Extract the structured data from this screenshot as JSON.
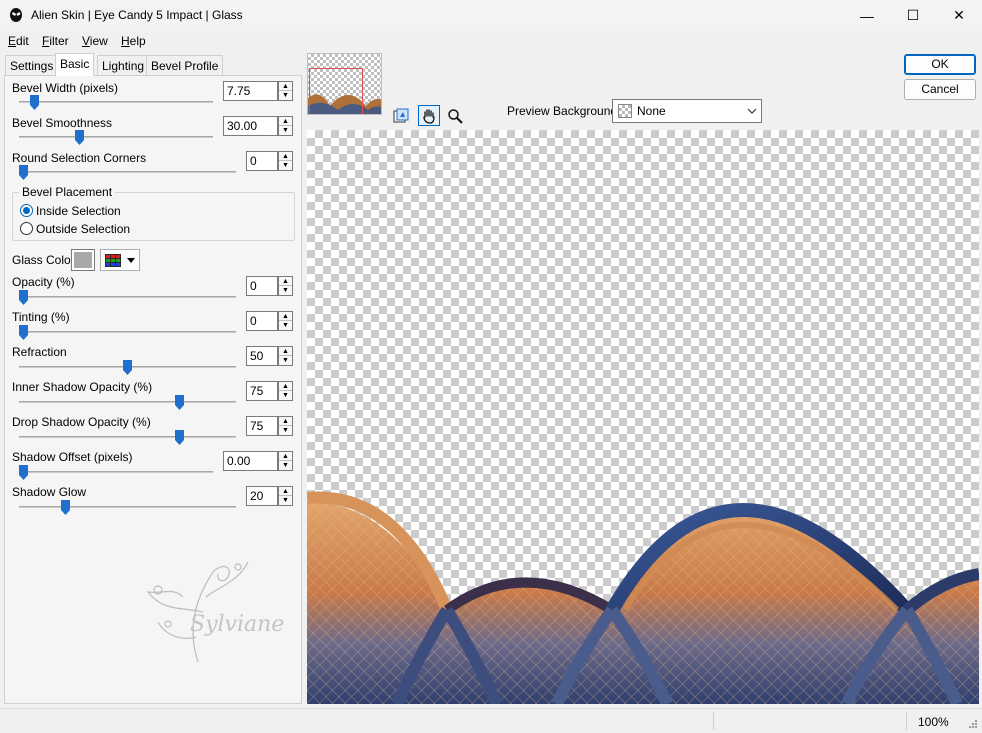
{
  "window": {
    "title": "Alien Skin | Eye Candy 5 Impact | Glass",
    "minimize": "—",
    "maximize": "☐",
    "close": "✕"
  },
  "menu": [
    {
      "label": "Edit",
      "mnemonic": "E",
      "rest": "dit"
    },
    {
      "label": "Filter",
      "mnemonic": "F",
      "rest": "ilter"
    },
    {
      "label": "View",
      "mnemonic": "V",
      "rest": "iew"
    },
    {
      "label": "Help",
      "mnemonic": "H",
      "rest": "elp"
    }
  ],
  "tabs": [
    "Settings",
    "Basic",
    "Lighting",
    "Bevel Profile"
  ],
  "active_tab": "Basic",
  "controls": {
    "bevel_width": {
      "label": "Bevel Width (pixels)",
      "value": "7.75",
      "level": 0.06
    },
    "bevel_smoothness": {
      "label": "Bevel Smoothness",
      "value": "30.00",
      "level": 0.3
    },
    "round_corners": {
      "label": "Round Selection Corners",
      "value": "0",
      "level": 0.0
    },
    "opacity": {
      "label": "Opacity (%)",
      "value": "0",
      "level": 0.0
    },
    "tinting": {
      "label": "Tinting (%)",
      "value": "0",
      "level": 0.0
    },
    "refraction": {
      "label": "Refraction",
      "value": "50",
      "level": 0.5
    },
    "inner_shadow": {
      "label": "Inner Shadow Opacity (%)",
      "value": "75",
      "level": 0.75
    },
    "drop_shadow": {
      "label": "Drop Shadow Opacity (%)",
      "value": "75",
      "level": 0.75
    },
    "shadow_offset": {
      "label": "Shadow Offset (pixels)",
      "value": "0.00",
      "level": 0.0
    },
    "shadow_glow": {
      "label": "Shadow Glow",
      "value": "20",
      "level": 0.2
    }
  },
  "placement": {
    "legend": "Bevel Placement",
    "inside": "Inside Selection",
    "outside": "Outside Selection",
    "selected": "inside"
  },
  "glass_color": {
    "label": "Glass Color",
    "swatch": "#a8a8a8"
  },
  "buttons": {
    "ok": "OK",
    "cancel": "Cancel"
  },
  "preview": {
    "bg_label": "Preview Background:",
    "bg_value": "None",
    "tools": [
      "hand-icon",
      "zoom-icon",
      "navigator-icon"
    ],
    "active_tool": "hand-icon"
  },
  "watermark": "Sylviane",
  "status": {
    "zoom": "100%"
  },
  "colors": {
    "accent": "#0067c0",
    "thumb": "#1f6fcf"
  }
}
